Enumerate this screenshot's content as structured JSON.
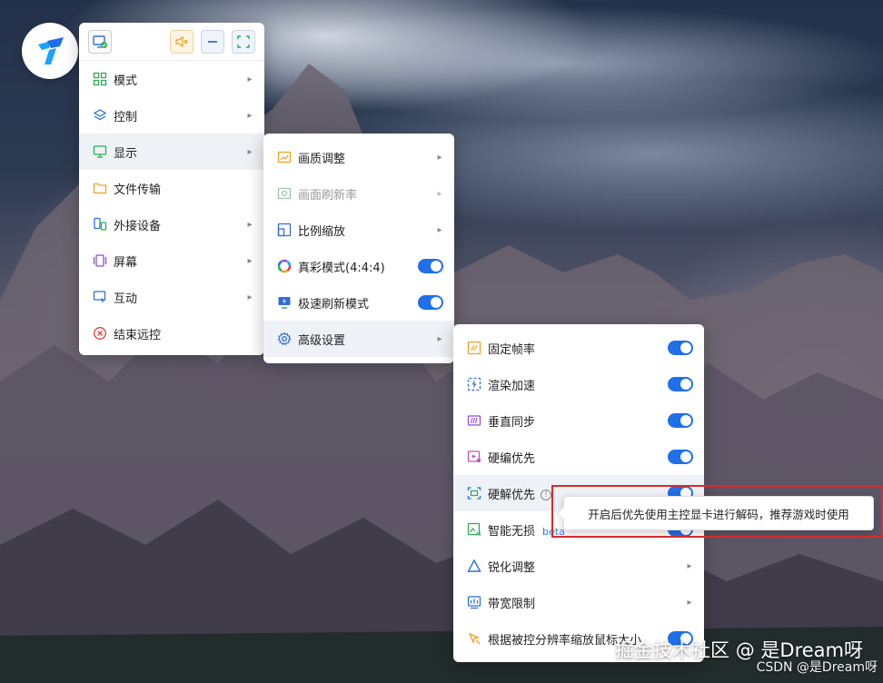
{
  "main_menu": {
    "items": [
      {
        "label": "模式",
        "icon": "grid-icon",
        "icon_color": "#2eaa55"
      },
      {
        "label": "控制",
        "icon": "layers-icon",
        "icon_color": "#2f6fd8"
      },
      {
        "label": "显示",
        "icon": "monitor-icon",
        "icon_color": "#2eaa55"
      },
      {
        "label": "文件传输",
        "icon": "folder-icon",
        "icon_color": "#f0a020"
      },
      {
        "label": "外接设备",
        "icon": "devices-icon",
        "icon_color": "#2f6fd8"
      },
      {
        "label": "屏幕",
        "icon": "screens-icon",
        "icon_color": "#8a4fd8"
      },
      {
        "label": "互动",
        "icon": "interact-icon",
        "icon_color": "#2f6fd8"
      },
      {
        "label": "结束远控",
        "icon": "close-circle-icon",
        "icon_color": "#e04040"
      }
    ]
  },
  "display_menu": {
    "items": [
      {
        "label": "画质调整"
      },
      {
        "label": "画面刷新率"
      },
      {
        "label": "比例缩放"
      },
      {
        "label": "真彩模式(4:4:4)"
      },
      {
        "label": "极速刷新模式"
      },
      {
        "label": "高级设置"
      }
    ]
  },
  "advanced_menu": {
    "items": [
      {
        "label": "固定帧率"
      },
      {
        "label": "渲染加速"
      },
      {
        "label": "垂直同步"
      },
      {
        "label": "硬编优先"
      },
      {
        "label": "硬解优先"
      },
      {
        "label": "智能无损",
        "badge": "beta"
      },
      {
        "label": "锐化调整"
      },
      {
        "label": "带宽限制"
      },
      {
        "label": "根据被控分辨率缩放鼠标大小"
      }
    ]
  },
  "tooltip": {
    "text": "开启后优先使用主控显卡进行解码，推荐游戏时使用"
  },
  "watermark": {
    "main": "掘金技术社区 @ 是Dream呀",
    "sub": "CSDN @是Dream呀"
  },
  "colors": {
    "accent": "#1f6fe8",
    "highlight": "#d92b2b"
  }
}
